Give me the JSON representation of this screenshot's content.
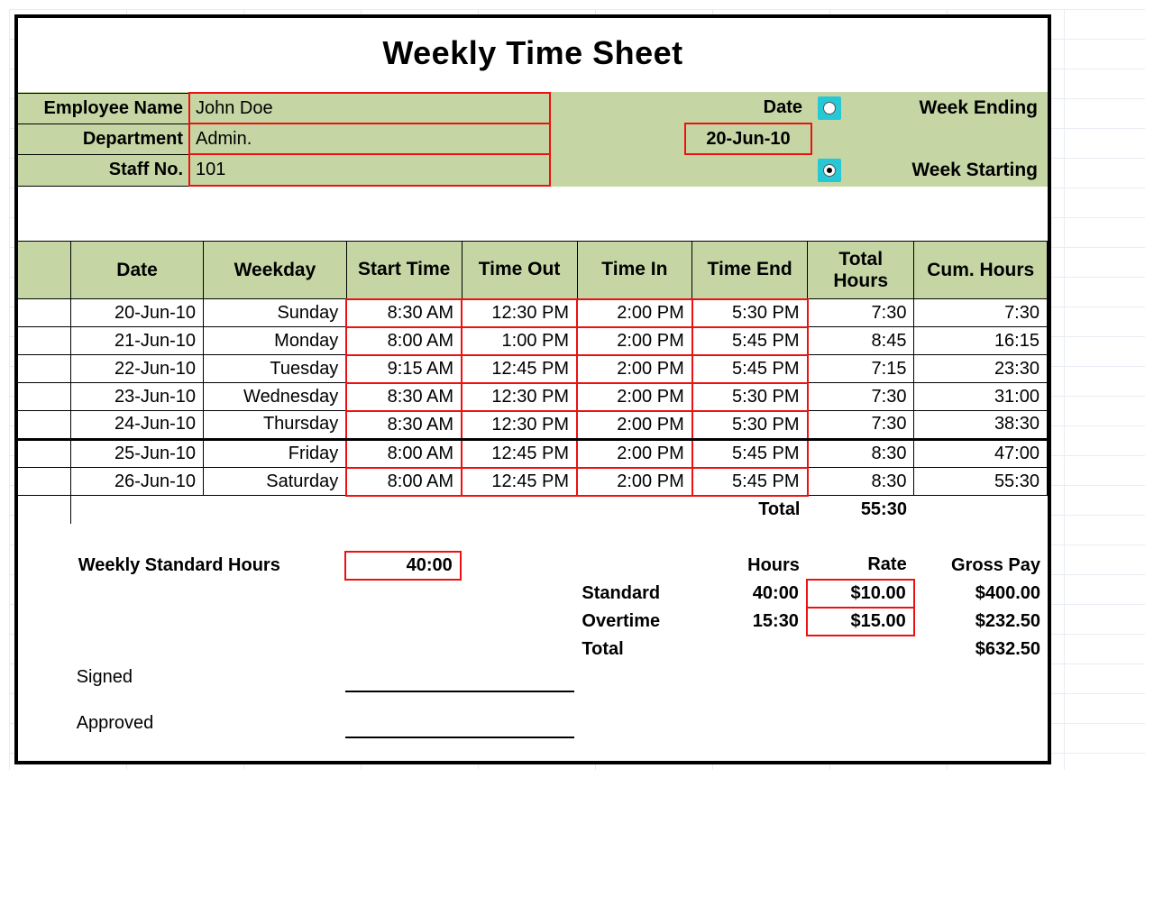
{
  "title": "Weekly Time Sheet",
  "header": {
    "employee_name_label": "Employee Name",
    "employee_name": "John Doe",
    "department_label": "Department",
    "department": "Admin.",
    "staff_no_label": "Staff No.",
    "staff_no": "101",
    "date_label": "Date",
    "date_value": "20-Jun-10",
    "week_ending_label": "Week Ending",
    "week_starting_label": "Week Starting"
  },
  "columns": {
    "date": "Date",
    "weekday": "Weekday",
    "start_time": "Start Time",
    "time_out": "Time Out",
    "time_in": "Time In",
    "time_end": "Time End",
    "total_hours": "Total Hours",
    "cum_hours": "Cum. Hours"
  },
  "rows": [
    {
      "date": "20-Jun-10",
      "weekday": "Sunday",
      "start": "8:30 AM",
      "out": "12:30 PM",
      "in": "2:00 PM",
      "end": "5:30 PM",
      "total": "7:30",
      "cum": "7:30"
    },
    {
      "date": "21-Jun-10",
      "weekday": "Monday",
      "start": "8:00 AM",
      "out": "1:00 PM",
      "in": "2:00 PM",
      "end": "5:45 PM",
      "total": "8:45",
      "cum": "16:15"
    },
    {
      "date": "22-Jun-10",
      "weekday": "Tuesday",
      "start": "9:15 AM",
      "out": "12:45 PM",
      "in": "2:00 PM",
      "end": "5:45 PM",
      "total": "7:15",
      "cum": "23:30"
    },
    {
      "date": "23-Jun-10",
      "weekday": "Wednesday",
      "start": "8:30 AM",
      "out": "12:30 PM",
      "in": "2:00 PM",
      "end": "5:30 PM",
      "total": "7:30",
      "cum": "31:00"
    },
    {
      "date": "24-Jun-10",
      "weekday": "Thursday",
      "start": "8:30 AM",
      "out": "12:30 PM",
      "in": "2:00 PM",
      "end": "5:30 PM",
      "total": "7:30",
      "cum": "38:30"
    },
    {
      "date": "25-Jun-10",
      "weekday": "Friday",
      "start": "8:00 AM",
      "out": "12:45 PM",
      "in": "2:00 PM",
      "end": "5:45 PM",
      "total": "8:30",
      "cum": "47:00"
    },
    {
      "date": "26-Jun-10",
      "weekday": "Saturday",
      "start": "8:00 AM",
      "out": "12:45 PM",
      "in": "2:00 PM",
      "end": "5:45 PM",
      "total": "8:30",
      "cum": "55:30"
    }
  ],
  "total_label": "Total",
  "total_hours": "55:30",
  "summary": {
    "weekly_std_label": "Weekly Standard Hours",
    "weekly_std_value": "40:00",
    "hours_hdr": "Hours",
    "rate_hdr": "Rate",
    "gross_hdr": "Gross Pay",
    "standard_label": "Standard",
    "standard_hours": "40:00",
    "standard_rate": "$10.00",
    "standard_gross": "$400.00",
    "overtime_label": "Overtime",
    "overtime_hours": "15:30",
    "overtime_rate": "$15.00",
    "overtime_gross": "$232.50",
    "total_label": "Total",
    "total_gross": "$632.50"
  },
  "sign": {
    "signed": "Signed",
    "approved": "Approved"
  }
}
